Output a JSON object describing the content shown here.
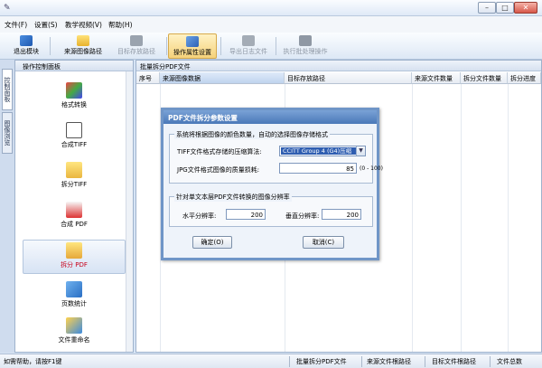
{
  "window": {
    "icon": "app-icon",
    "controls": [
      "minimize",
      "maximize",
      "close"
    ]
  },
  "menu": [
    "文件(F)",
    "设置(S)",
    "教学视频(V)",
    "帮助(H)"
  ],
  "toolbar": [
    {
      "label": "退出模块",
      "icon": "exit-icon",
      "disabled": false,
      "active": false
    },
    {
      "label": "来源图像路径",
      "icon": "folder-icon",
      "disabled": false,
      "active": false
    },
    {
      "label": "目标存放路径",
      "icon": "folder-save-icon",
      "disabled": true,
      "active": false
    },
    {
      "label": "操作属性设置",
      "icon": "settings-icon",
      "disabled": false,
      "active": true
    },
    {
      "label": "导出日志文件",
      "icon": "export-icon",
      "disabled": true,
      "active": false
    },
    {
      "label": "执行批处理操作",
      "icon": "run-icon",
      "disabled": true,
      "active": false
    }
  ],
  "sidetabs": [
    "控制面板",
    "图像浏览"
  ],
  "left_panel": {
    "title": "操作控制面板",
    "modules": [
      {
        "label": "格式转换",
        "icon": "format-convert-icon",
        "active": false
      },
      {
        "label": "合成TIFF",
        "icon": "tiff-merge-icon",
        "active": false
      },
      {
        "label": "拆分TIFF",
        "icon": "tiff-split-icon",
        "active": false
      },
      {
        "label": "合成 PDF",
        "icon": "pdf-merge-icon",
        "active": false
      },
      {
        "label": "拆分 PDF",
        "icon": "pdf-split-icon",
        "active": true
      },
      {
        "label": "页数统计",
        "icon": "page-count-icon",
        "active": false
      },
      {
        "label": "文件重命名",
        "icon": "rename-icon",
        "active": false
      }
    ]
  },
  "right_panel": {
    "title": "批量拆分PDF文件",
    "columns": [
      "序号",
      "来源图像数据",
      "目标存放路径",
      "来源文件数量",
      "拆分文件数量",
      "拆分进度"
    ]
  },
  "dialog": {
    "title": "PDF文件拆分参数设置",
    "group1": {
      "title": "系统将根据图像的颜色数量，自动的选择图像存储格式",
      "compression_label": "TIFF文件格式存储的压缩算法:",
      "compression_value": "CCITT Group 4 (G4)压缩",
      "jpg_label": "JPG文件格式图像的质量损耗:",
      "jpg_value": "85",
      "jpg_range": "(0 - 100)"
    },
    "group2": {
      "title": "针对单文本层PDF文件转换的图像分辨率",
      "horizontal_label": "水平分辨率:",
      "horizontal_value": "200",
      "vertical_label": "垂直分辨率:",
      "vertical_value": "200"
    },
    "ok_label": "确定(O)",
    "cancel_label": "取消(C)"
  },
  "status": [
    "如需帮助，请按F1键",
    "批量拆分PDF文件",
    "来源文件根路径",
    "目标文件根路径",
    "文件总数"
  ]
}
